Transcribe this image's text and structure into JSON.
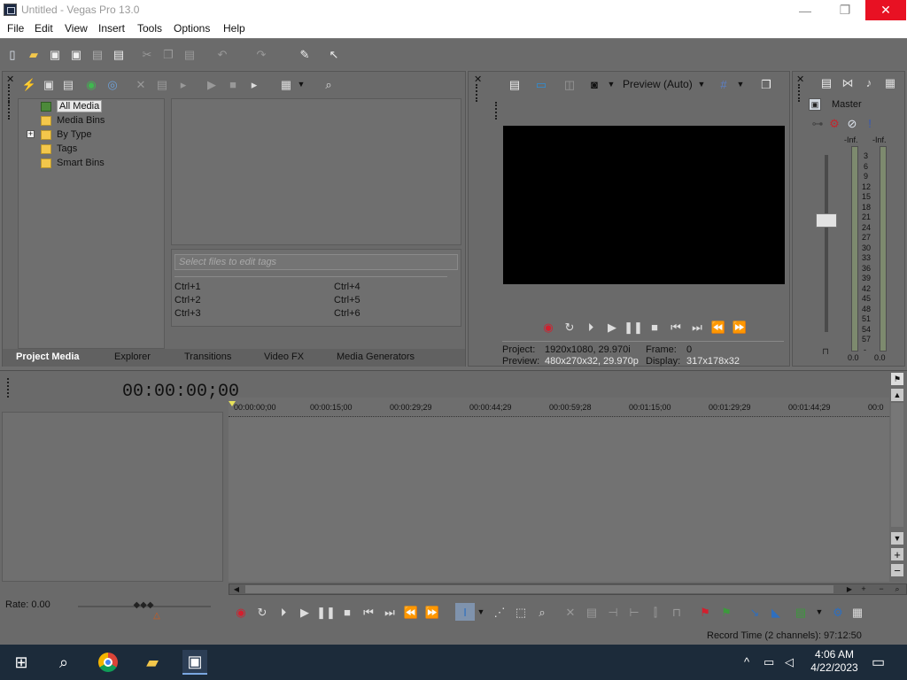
{
  "window": {
    "title": "Untitled - Vegas Pro 13.0",
    "controls": {
      "minimize": "—",
      "restore": "❐",
      "close": "✕"
    }
  },
  "menu": [
    "File",
    "Edit",
    "View",
    "Insert",
    "Tools",
    "Options",
    "Help"
  ],
  "media": {
    "tree": [
      "All Media",
      "Media Bins",
      "By Type",
      "Tags",
      "Smart Bins"
    ],
    "expander": "+",
    "tag_placeholder": "Select files to edit tags",
    "shortcuts": [
      "Ctrl+1",
      "Ctrl+2",
      "Ctrl+3",
      "Ctrl+4",
      "Ctrl+5",
      "Ctrl+6"
    ],
    "tabs": [
      "Project Media",
      "Explorer",
      "Transitions",
      "Video FX",
      "Media Generators"
    ]
  },
  "preview": {
    "mode": "Preview (Auto)",
    "project_label": "Project:",
    "project_value": "1920x1080, 29.970i",
    "preview_label": "Preview:",
    "preview_value": "480x270x32, 29.970p",
    "frame_label": "Frame:",
    "frame_value": "0",
    "display_label": "Display:",
    "display_value": "317x178x32"
  },
  "mixer": {
    "title": "Master",
    "left_peak": "-Inf.",
    "right_peak": "-Inf.",
    "scale": [
      "3",
      "6",
      "9",
      "12",
      "15",
      "18",
      "21",
      "24",
      "27",
      "30",
      "33",
      "36",
      "39",
      "42",
      "45",
      "48",
      "51",
      "54",
      "57",
      "-"
    ],
    "left_value": "0.0",
    "right_value": "0.0"
  },
  "timeline": {
    "timecode": "00:00:00;00",
    "ruler": [
      "00:00:00;00",
      "00:00:15;00",
      "00:00:29;29",
      "00:00:44;29",
      "00:00:59;28",
      "00:01:15;00",
      "00:01:29;29",
      "00:01:44;29",
      "00:0"
    ],
    "rate": "Rate: 0.00"
  },
  "status": {
    "record_time": "Record Time (2 channels): 97:12:50"
  },
  "taskbar": {
    "time": "4:06 AM",
    "date": "4/22/2023"
  },
  "colors": {
    "accent_close": "#e81123",
    "panel_bg": "#6a6a6a",
    "taskbar_bg": "#1c2b3a"
  }
}
